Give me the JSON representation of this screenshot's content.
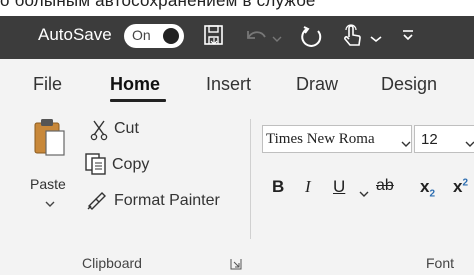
{
  "caption": "о болыным автосохранением в службе",
  "titlebar": {
    "autosave_label": "AutoSave",
    "toggle_state": "On",
    "icons": [
      "save-icon",
      "undo-icon",
      "redo-icon",
      "touch-mode-icon",
      "customize-toolbar-icon"
    ]
  },
  "tabs": [
    {
      "label": "File"
    },
    {
      "label": "Home",
      "selected": true
    },
    {
      "label": "Insert"
    },
    {
      "label": "Draw"
    },
    {
      "label": "Design"
    }
  ],
  "clipboard": {
    "paste_label": "Paste",
    "cut_label": "Cut",
    "copy_label": "Copy",
    "format_painter_label": "Format Painter",
    "group_label": "Clipboard"
  },
  "font": {
    "font_name": "Times New Roma",
    "font_size": "12",
    "bold": "B",
    "italic": "I",
    "underline": "U",
    "strikethrough": "ab",
    "subscript_base": "x",
    "subscript_mark": "2",
    "superscript_base": "x",
    "superscript_mark": "2",
    "group_label": "Font"
  },
  "colors": {
    "titlebar_bg": "#3c3c3c",
    "ribbon_bg": "#f3f3f3",
    "accent_blue": "#2b6cb0"
  }
}
